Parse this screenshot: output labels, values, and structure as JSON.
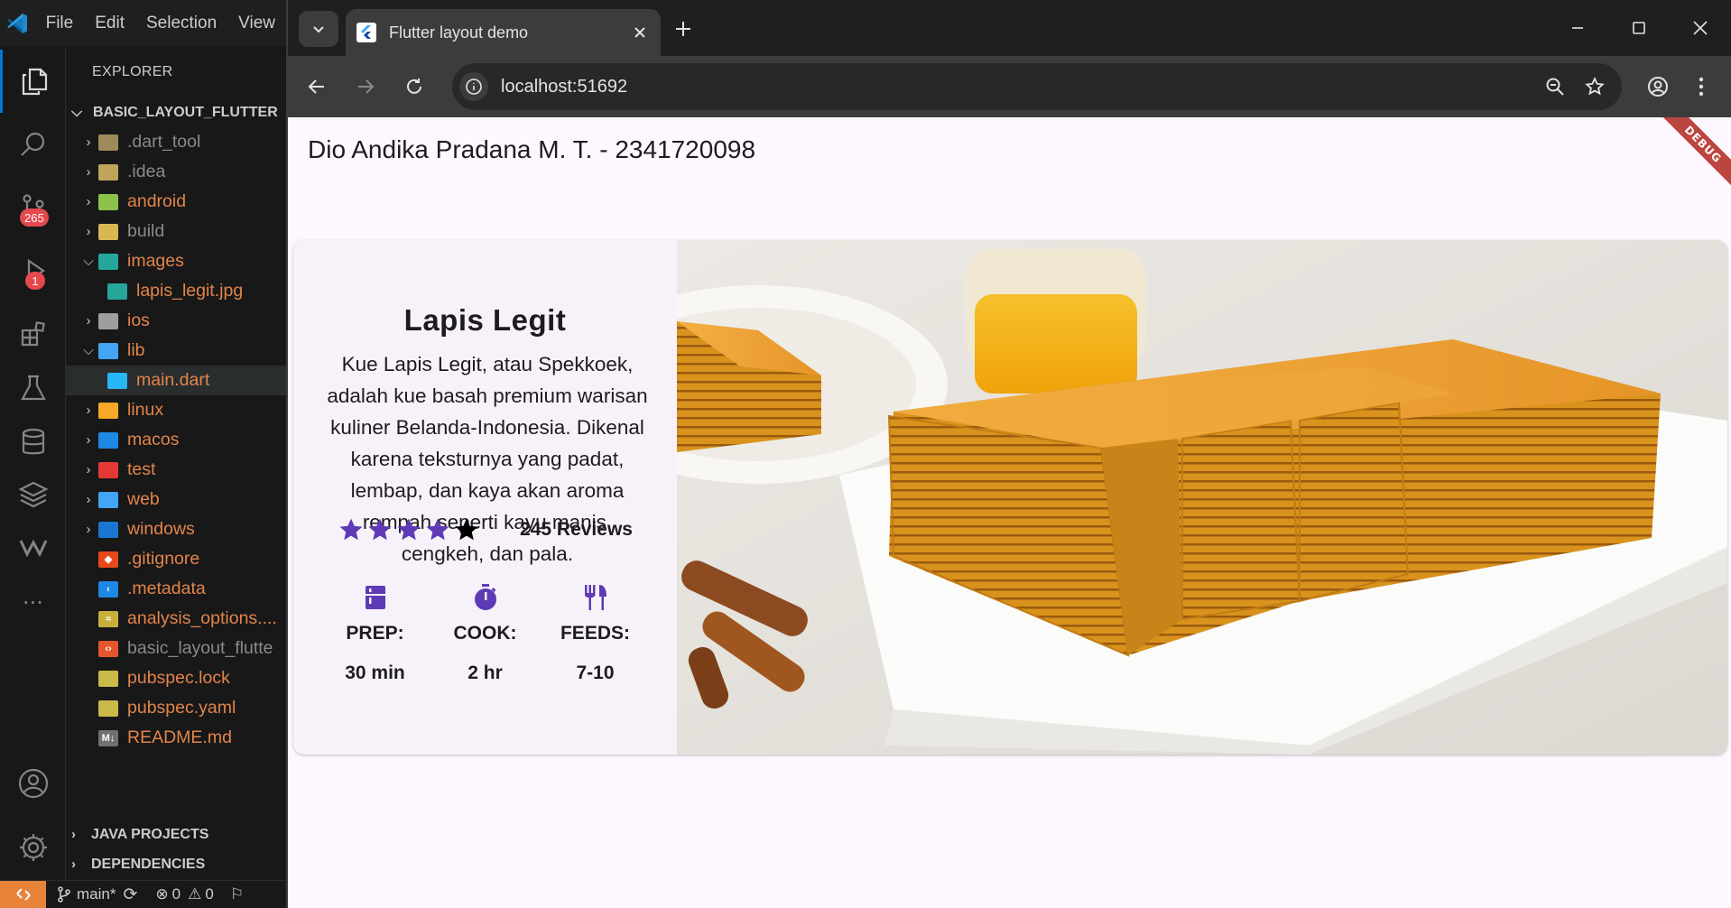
{
  "vscode": {
    "menu": [
      "File",
      "Edit",
      "Selection",
      "View"
    ],
    "explorer_title": "EXPLORER",
    "project_name": "BASIC_LAYOUT_FLUTTER",
    "badges": {
      "source_control": "265",
      "run_debug": "1"
    },
    "tree": [
      {
        "label": ".dart_tool",
        "kind": "folder",
        "color": "dim"
      },
      {
        "label": ".idea",
        "kind": "folder",
        "color": "dim"
      },
      {
        "label": "android",
        "kind": "folder",
        "color": "orange"
      },
      {
        "label": "build",
        "kind": "folder",
        "color": "dim"
      },
      {
        "label": "images",
        "kind": "folder-open",
        "color": "orange"
      },
      {
        "label": "lapis_legit.jpg",
        "kind": "image",
        "color": "orange"
      },
      {
        "label": "ios",
        "kind": "folder",
        "color": "orange"
      },
      {
        "label": "lib",
        "kind": "folder-open",
        "color": "orange"
      },
      {
        "label": "main.dart",
        "kind": "dart",
        "color": "orange"
      },
      {
        "label": "linux",
        "kind": "folder",
        "color": "orange"
      },
      {
        "label": "macos",
        "kind": "folder",
        "color": "orange"
      },
      {
        "label": "test",
        "kind": "folder",
        "color": "orange"
      },
      {
        "label": "web",
        "kind": "folder",
        "color": "orange"
      },
      {
        "label": "windows",
        "kind": "folder",
        "color": "orange"
      },
      {
        "label": ".gitignore",
        "kind": "git",
        "color": "orange"
      },
      {
        "label": ".metadata",
        "kind": "flutter",
        "color": "orange"
      },
      {
        "label": "analysis_options....",
        "kind": "yaml",
        "color": "orange"
      },
      {
        "label": "basic_layout_flutte",
        "kind": "xml",
        "color": "dim"
      },
      {
        "label": "pubspec.lock",
        "kind": "lock",
        "color": "orange"
      },
      {
        "label": "pubspec.yaml",
        "kind": "lock",
        "color": "orange"
      },
      {
        "label": "README.md",
        "kind": "md",
        "color": "orange"
      }
    ],
    "sections": [
      "JAVA PROJECTS",
      "DEPENDENCIES"
    ],
    "status": {
      "branch": "main*",
      "errors": "0",
      "warnings": "0"
    }
  },
  "browser": {
    "tab_title": "Flutter layout demo",
    "url": "localhost:51692"
  },
  "app": {
    "appbar_title": "Dio Andika Pradana M. T. - 2341720098",
    "debug_banner": "DEBUG",
    "recipe": {
      "title": "Lapis Legit",
      "description": "Kue Lapis Legit, atau Spekkoek, adalah kue basah premium warisan kuliner Belanda-Indonesia. Dikenal karena teksturnya yang padat, lembap, dan kaya akan aroma rempah seperti kayu manis, cengkeh, dan pala.",
      "rating": {
        "filled_stars": 4,
        "total_stars": 5,
        "reviews": "245 Reviews"
      },
      "info": [
        {
          "icon": "kitchen-icon",
          "label": "PREP:",
          "value": "30 min"
        },
        {
          "icon": "timer-icon",
          "label": "COOK:",
          "value": "2 hr"
        },
        {
          "icon": "restaurant-icon",
          "label": "FEEDS:",
          "value": "7-10"
        }
      ]
    },
    "colors": {
      "accent": "#5e3ab5",
      "background": "#fdf7ff",
      "card": "#f7f2fa"
    }
  }
}
